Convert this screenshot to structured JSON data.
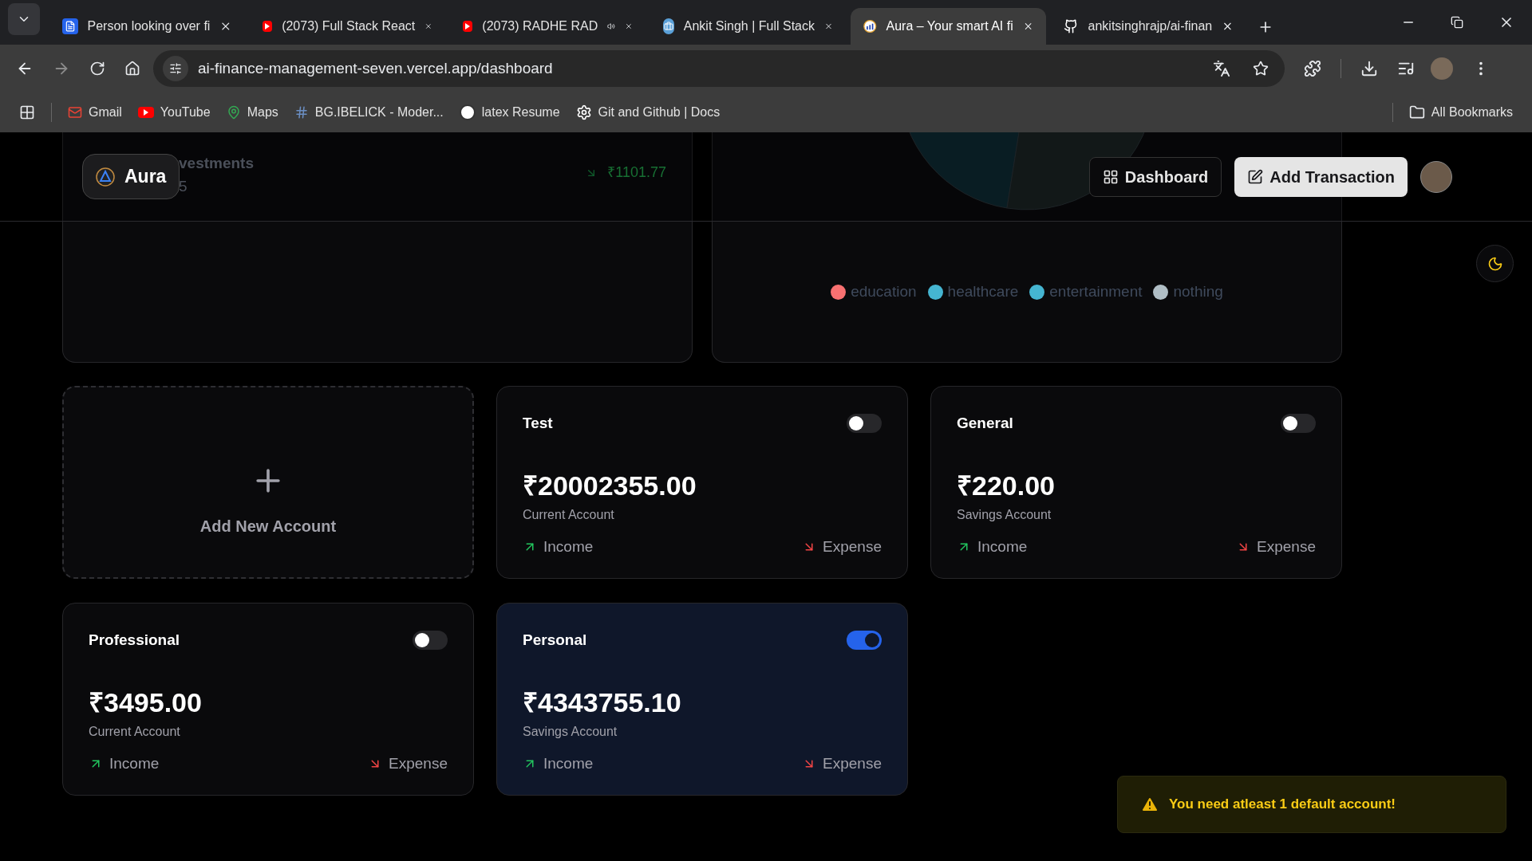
{
  "browser": {
    "tabs": [
      {
        "title": "Person looking over fi",
        "kind": "doc",
        "audio": false,
        "selected": false
      },
      {
        "title": "(2073) Full Stack React",
        "kind": "youtube",
        "audio": false,
        "selected": false
      },
      {
        "title": "(2073) RADHE RAD",
        "kind": "youtube",
        "audio": true,
        "selected": false
      },
      {
        "title": "Ankit Singh | Full Stack",
        "kind": "bag",
        "audio": false,
        "selected": false
      },
      {
        "title": "Aura – Your smart AI fi",
        "kind": "aura",
        "audio": false,
        "selected": true
      },
      {
        "title": "ankitsinghrajp/ai-finan",
        "kind": "github",
        "audio": false,
        "selected": false
      }
    ],
    "address": "ai-finance-management-seven.vercel.app/dashboard",
    "bookmarks": [
      {
        "label": "Gmail",
        "kind": "gmail"
      },
      {
        "label": "YouTube",
        "kind": "youtube"
      },
      {
        "label": "Maps",
        "kind": "maps"
      },
      {
        "label": "BG.IBELICK - Moder...",
        "kind": "hash"
      },
      {
        "label": "latex Resume",
        "kind": "latex"
      },
      {
        "label": "Git and Github | Docs",
        "kind": "gear"
      }
    ],
    "all_bookmarks": "All Bookmarks"
  },
  "header": {
    "logo": "Aura",
    "buttons": [
      {
        "label": "Dashboard",
        "kind": "outline"
      },
      {
        "label": "Add Transaction",
        "kind": "solid"
      }
    ]
  },
  "top_cards": {
    "recent": {
      "title": "vestments",
      "subtitle": "5",
      "amount": "₹1101.77"
    },
    "breakdown": {
      "legend": [
        {
          "label": "education",
          "color": "#f87171"
        },
        {
          "label": "healthcare",
          "color": "#45b5d1"
        },
        {
          "label": "entertainment",
          "color": "#45b5d1"
        },
        {
          "label": "nothing",
          "color": "#b0bec5"
        }
      ]
    }
  },
  "accounts": [
    {
      "kind": "add",
      "label": "Add New Account"
    },
    {
      "kind": "account",
      "name": "Test",
      "balance": "₹20002355.00",
      "type": "Current Account",
      "income": "Income",
      "expense": "Expense",
      "default": false
    },
    {
      "kind": "account",
      "name": "General",
      "balance": "₹220.00",
      "type": "Savings Account",
      "income": "Income",
      "expense": "Expense",
      "default": false
    },
    {
      "kind": "account",
      "name": "Professional",
      "balance": "₹3495.00",
      "type": "Current Account",
      "income": "Income",
      "expense": "Expense",
      "default": false
    },
    {
      "kind": "account",
      "name": "Personal",
      "balance": "₹4343755.10",
      "type": "Savings Account",
      "income": "Income",
      "expense": "Expense",
      "default": true
    }
  ],
  "toast": {
    "message": "You need atleast 1 default account!"
  }
}
